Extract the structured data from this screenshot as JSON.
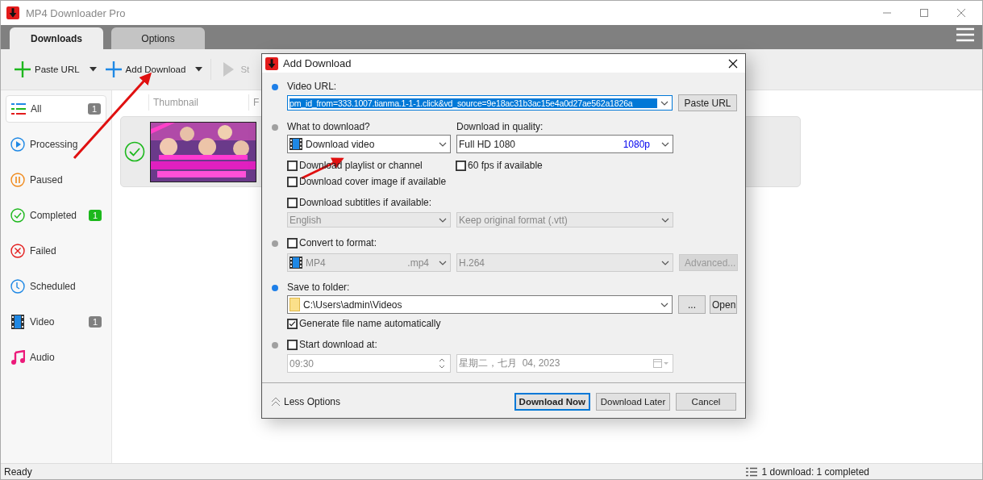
{
  "window": {
    "title": "MP4 Downloader Pro"
  },
  "tabs": [
    {
      "label": "Downloads",
      "selected": true
    },
    {
      "label": "Options",
      "selected": false
    }
  ],
  "toolbar": [
    {
      "kind": "plus",
      "label": "Paste URL",
      "color": "#1eb71e",
      "dropdown": true
    },
    {
      "kind": "plus",
      "label": "Add Download",
      "color": "#1e88e5",
      "dropdown": true
    },
    {
      "kind": "play",
      "label": "St",
      "color": "#c8c8c8",
      "dropdown": false
    }
  ],
  "sidebar": {
    "items": [
      {
        "kind": "all",
        "label": "All",
        "count": "1",
        "color": "#808080",
        "selected": true
      },
      {
        "kind": "processing",
        "label": "Processing",
        "selected": false
      },
      {
        "kind": "paused",
        "label": "Paused",
        "selected": false
      },
      {
        "kind": "completed",
        "label": "Completed",
        "count": "1",
        "color": "#1cb81c",
        "selected": false
      },
      {
        "kind": "failed",
        "label": "Failed",
        "selected": false
      },
      {
        "kind": "scheduled",
        "label": "Scheduled",
        "selected": false
      },
      {
        "kind": "video",
        "label": "Video",
        "count": "1",
        "color": "#808080",
        "selected": false
      },
      {
        "kind": "audio",
        "label": "Audio",
        "selected": false
      }
    ]
  },
  "list": {
    "columns": [
      "Thumbnail",
      "F"
    ],
    "rows": [
      {
        "kind": "picture",
        "completed": true
      }
    ]
  },
  "dialog": {
    "title": "Add Download",
    "url": {
      "color": "#1e7fe8",
      "label": "Video URL:",
      "value": "pm_id_from=333.1007.tianma.1-1-1.click&vd_source=9e18ac31b3ac15e4a0d27ae562a1826a",
      "button": "Paste URL"
    },
    "what": {
      "color": "#a0a0a0",
      "label": "What to download?",
      "value": "Download video",
      "quality_label": "Download in quality:",
      "quality": "Full HD 1080",
      "quality_tag": "1080p"
    },
    "options": [
      {
        "label": "Download playlist or channel",
        "checked": false
      },
      {
        "label": "60 fps if available",
        "checked": false
      },
      {
        "label": "Download cover image if available",
        "checked": false
      },
      {
        "label": "Download subtitles if available:",
        "checked": false
      }
    ],
    "subtitles": {
      "language": "English",
      "format": "Keep original format (.vtt)",
      "disabled": true
    },
    "convert": {
      "color": "#a0a0a0",
      "label": "Convert to format:",
      "checked": false,
      "format": "MP4",
      "ext": ".mp4",
      "codec": "H.264",
      "button": "Advanced...",
      "disabled": true
    },
    "folder": {
      "color": "#1e7fe8",
      "label": "Save to folder:",
      "path": "C:\\Users\\admin\\Videos",
      "browse": "...",
      "open": "Open",
      "auto_label": "Generate file name automatically",
      "auto_checked": true
    },
    "schedule": {
      "color": "#a0a0a0",
      "label": "Start download at:",
      "checked": false,
      "time": "09:30",
      "date": "星期二，七月  04, 2023",
      "disabled": true
    },
    "less": "Less Options",
    "buttons": [
      {
        "label": "Download Now",
        "default": true
      },
      {
        "label": "Download Later",
        "default": false
      },
      {
        "label": "Cancel",
        "default": false
      }
    ]
  },
  "status_bar": {
    "left": "Ready",
    "right": "1 download: 1 completed"
  }
}
